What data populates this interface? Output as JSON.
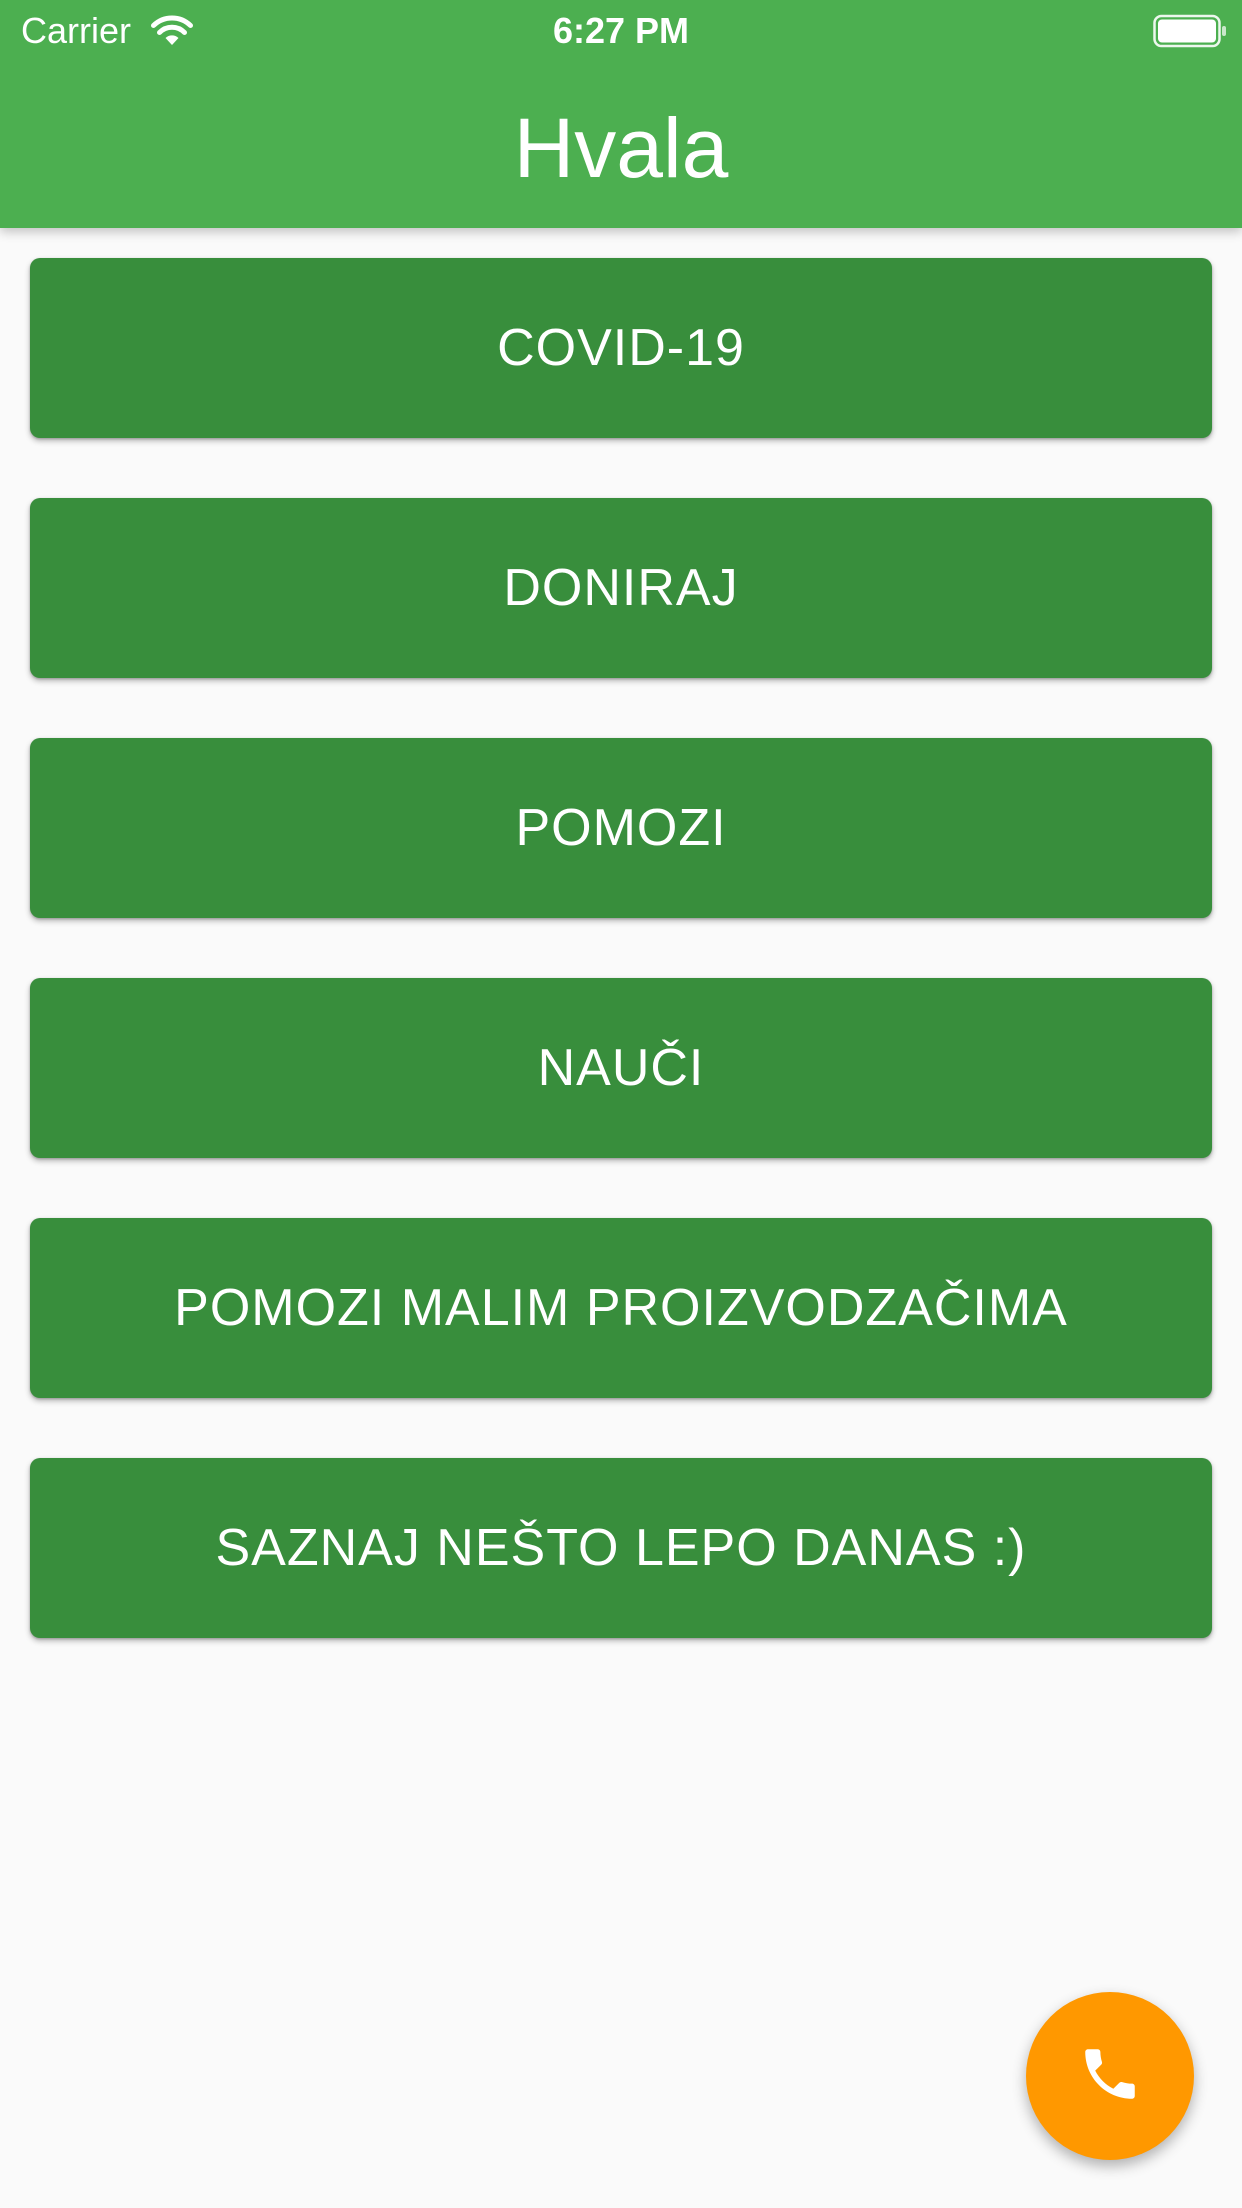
{
  "status_bar": {
    "carrier": "Carrier",
    "time": "6:27 PM"
  },
  "app_bar": {
    "title": "Hvala",
    "color": "#4caf50"
  },
  "menu": {
    "button_color": "#388e3c",
    "items": [
      {
        "label": "COVID-19"
      },
      {
        "label": "DONIRAJ"
      },
      {
        "label": "POMOZI"
      },
      {
        "label": "NAUČI"
      },
      {
        "label": "POMOZI MALIM PROIZVODZAČIMA"
      },
      {
        "label": "SAZNAJ NEŠTO LEPO DANAS :)"
      }
    ]
  },
  "fab": {
    "icon": "phone-icon",
    "color": "#ff9800"
  }
}
